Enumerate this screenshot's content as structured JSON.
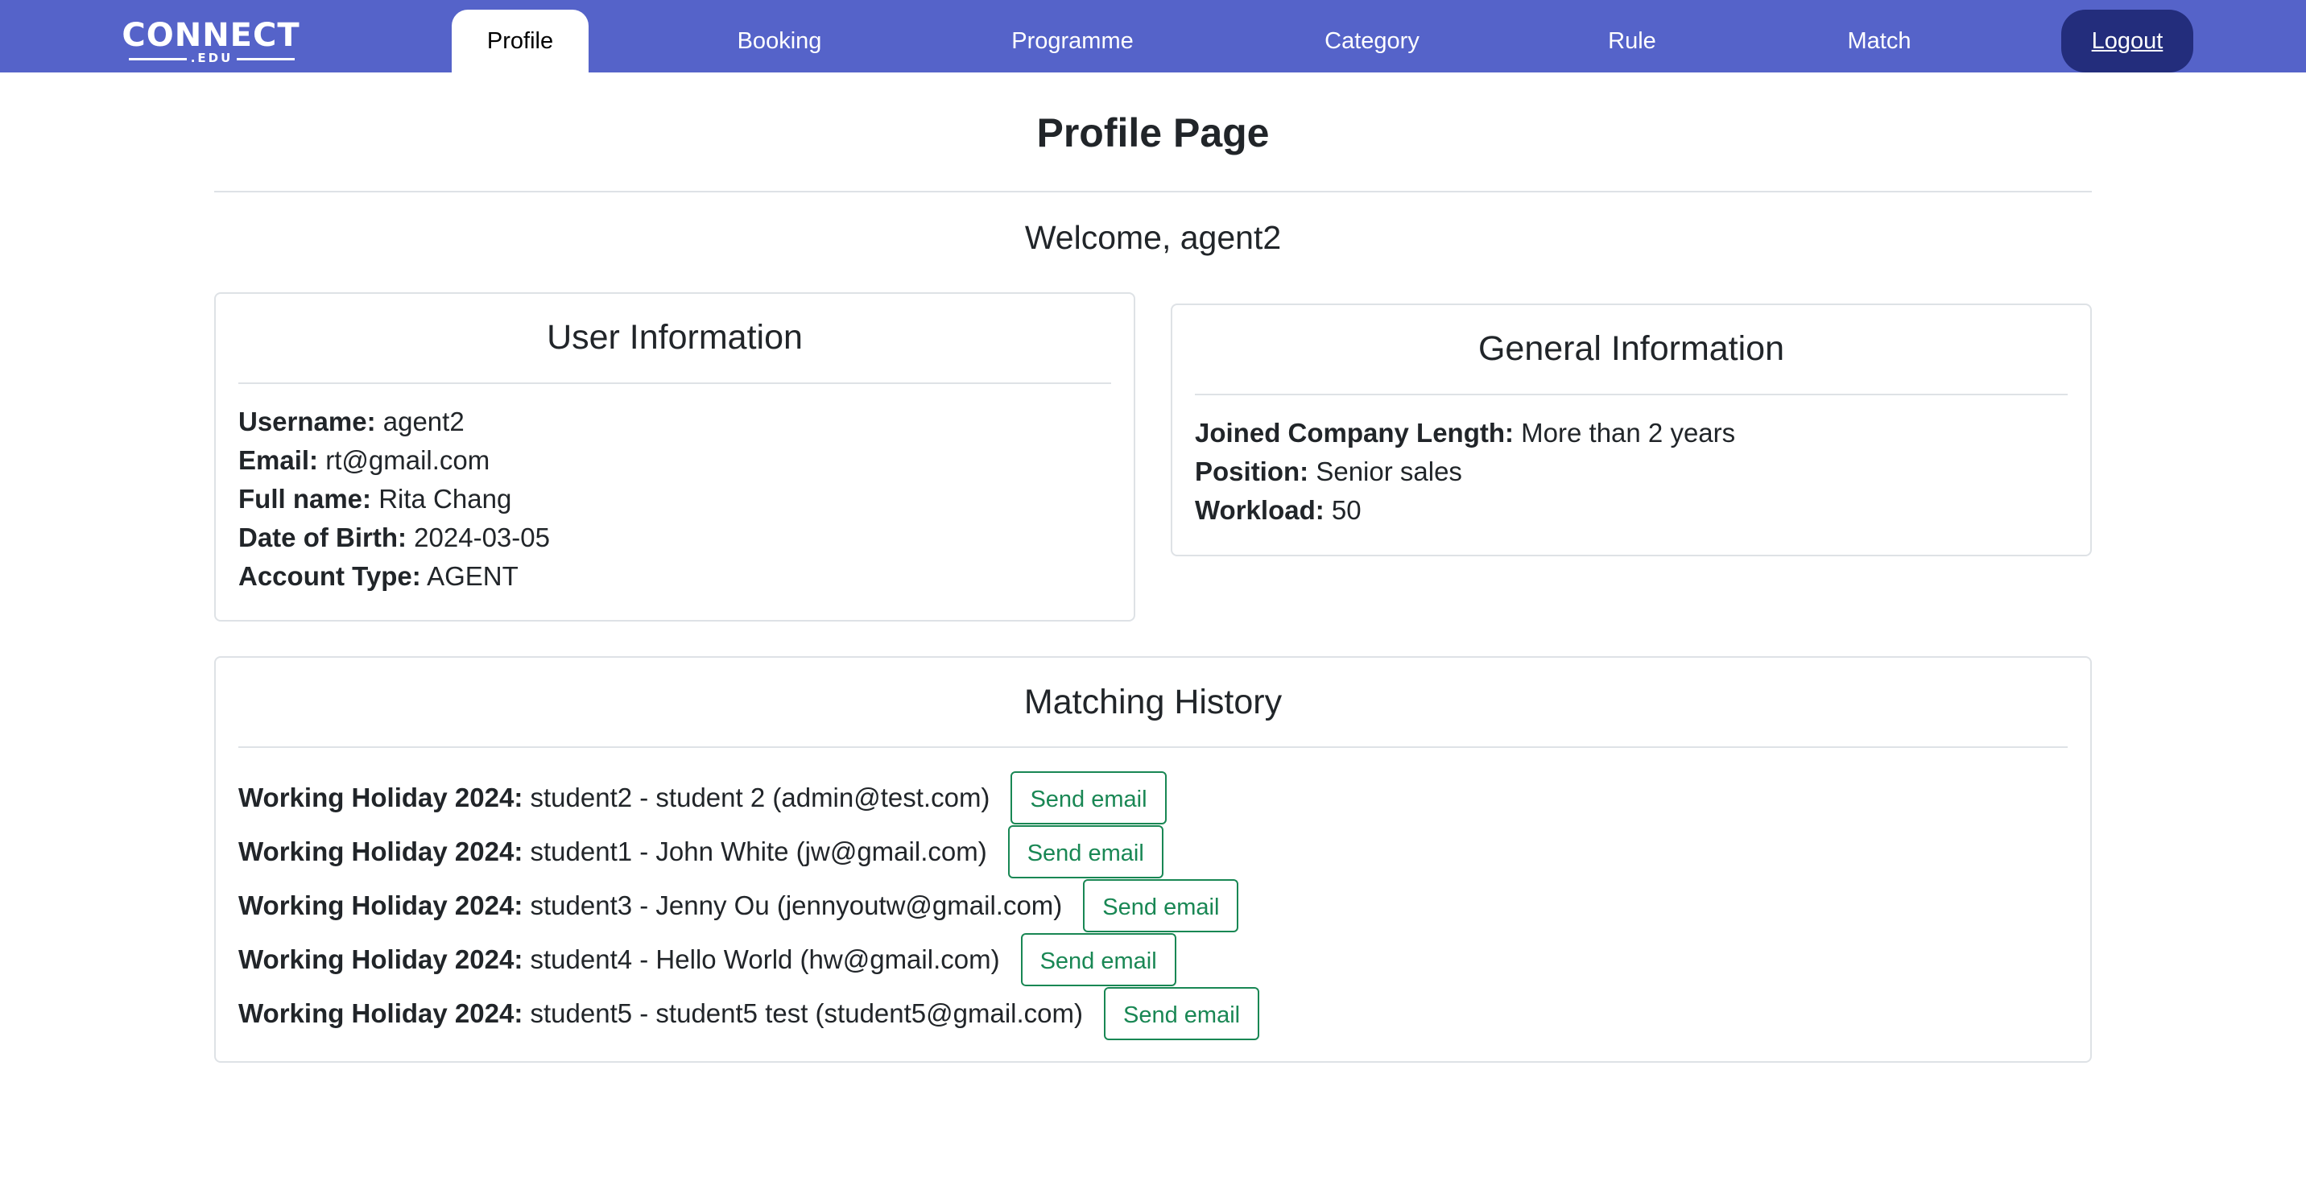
{
  "logo": {
    "main": "CONNECT",
    "sub": ".EDU"
  },
  "nav": {
    "items": [
      {
        "label": "Profile",
        "active": true
      },
      {
        "label": "Booking"
      },
      {
        "label": "Programme"
      },
      {
        "label": "Category"
      },
      {
        "label": "Rule"
      },
      {
        "label": "Match"
      }
    ],
    "logout_label": "Logout"
  },
  "page": {
    "title": "Profile Page",
    "welcome": "Welcome, agent2"
  },
  "user_info": {
    "title": "User Information",
    "fields": [
      {
        "label": "Username:",
        "value": "agent2"
      },
      {
        "label": "Email:",
        "value": "rt@gmail.com"
      },
      {
        "label": "Full name:",
        "value": "Rita Chang"
      },
      {
        "label": "Date of Birth:",
        "value": "2024-03-05"
      },
      {
        "label": "Account Type:",
        "value": "AGENT"
      }
    ]
  },
  "general_info": {
    "title": "General Information",
    "fields": [
      {
        "label": "Joined Company Length:",
        "value": "More than 2 years"
      },
      {
        "label": "Position:",
        "value": "Senior sales"
      },
      {
        "label": "Workload:",
        "value": "50"
      }
    ]
  },
  "matching_history": {
    "title": "Matching History",
    "rows": [
      {
        "programme": "Working Holiday 2024:",
        "detail": "student2 - student 2 (admin@test.com)",
        "button": "Send email"
      },
      {
        "programme": "Working Holiday 2024:",
        "detail": "student1 - John White (jw@gmail.com)",
        "button": "Send email"
      },
      {
        "programme": "Working Holiday 2024:",
        "detail": "student3 - Jenny Ou (jennyoutw@gmail.com)",
        "button": "Send email"
      },
      {
        "programme": "Working Holiday 2024:",
        "detail": "student4 - Hello World (hw@gmail.com)",
        "button": "Send email"
      },
      {
        "programme": "Working Holiday 2024:",
        "detail": "student5 - student5 test (student5@gmail.com)",
        "button": "Send email"
      }
    ]
  },
  "colors": {
    "navbar": "#5563c9",
    "logout_bg": "#232d7c",
    "success": "#198754",
    "border": "#dee2e6"
  }
}
